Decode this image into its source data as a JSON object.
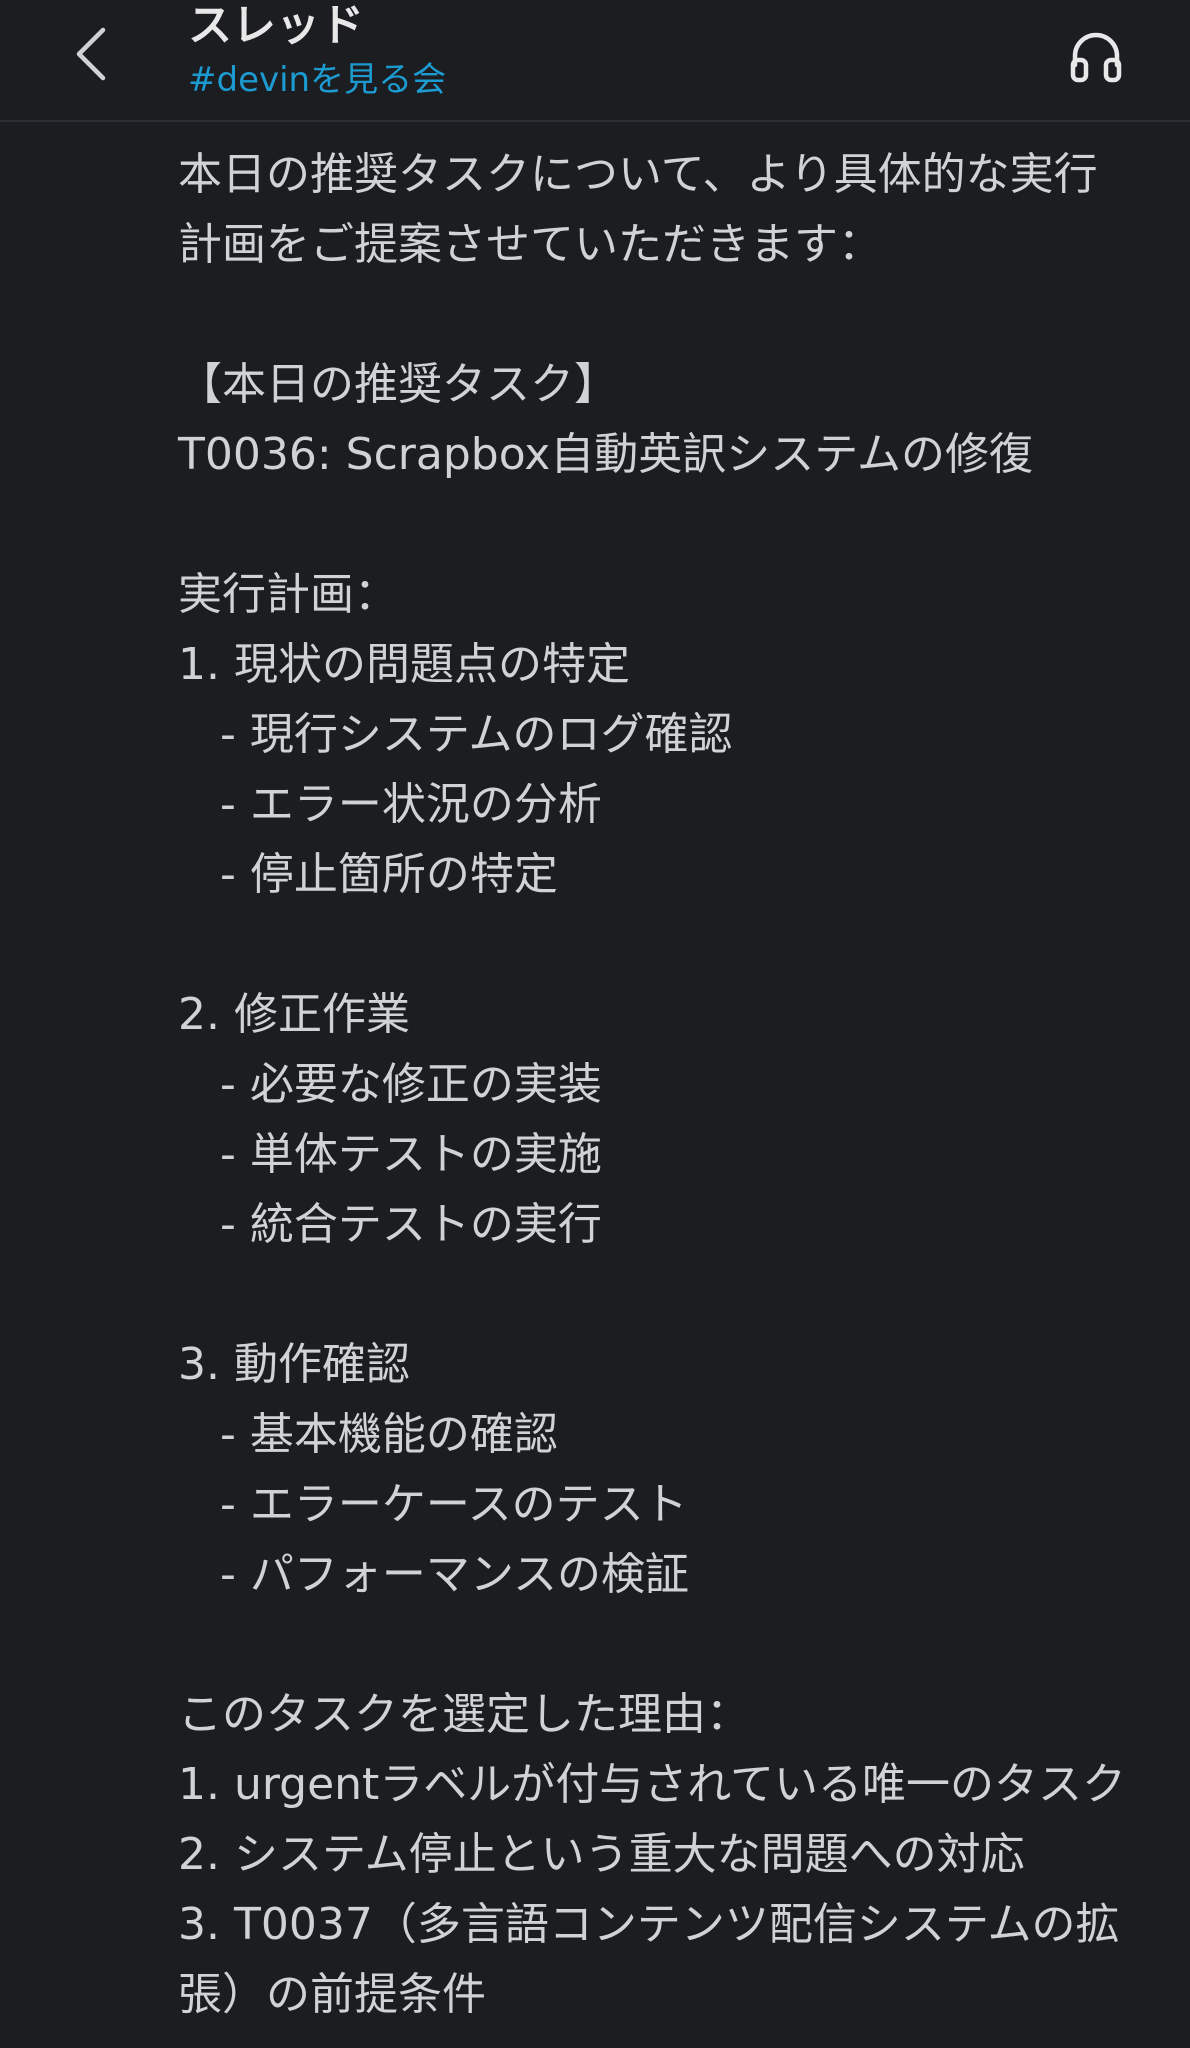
{
  "header": {
    "title": "スレッド",
    "channel": "#devinを見る会",
    "back_icon": "chevron-left-icon",
    "huddle_icon": "headphones-icon"
  },
  "message": {
    "text": "本日の推奨タスクについて、より具体的な実行計画をご提案させていただきます：\n\n【本日の推奨タスク】\nT0036: Scrapbox自動英訳システムの修復\n\n実行計画：\n1. 現状の問題点の特定\n   - 現行システムのログ確認\n   - エラー状況の分析\n   - 停止箇所の特定\n\n2. 修正作業\n   - 必要な修正の実装\n   - 単体テストの実施\n   - 統合テストの実行\n\n3. 動作確認\n   - 基本機能の確認\n   - エラーケースのテスト\n   - パフォーマンスの検証\n\nこのタスクを選定した理由：\n1. urgentラベルが付与されている唯一のタスク\n2. システム停止という重大な問題への対応\n3. T0037（多言語コンテンツ配信システムの拡張）の前提条件"
  },
  "colors": {
    "background": "#1b1d21",
    "text": "#d1d2d3",
    "link": "#1d9bd1",
    "divider": "#2c2e33"
  }
}
